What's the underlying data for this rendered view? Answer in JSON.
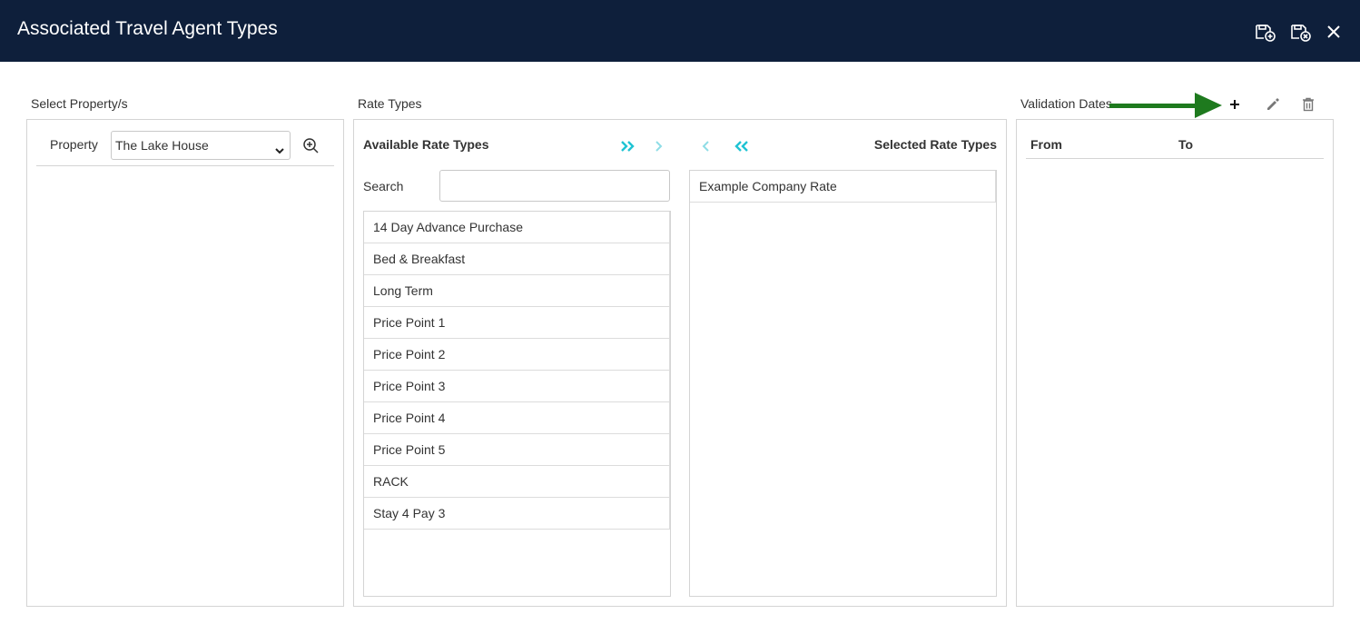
{
  "window": {
    "title": "Associated Travel Agent Types",
    "actions": [
      "save-add-icon",
      "save-close-icon",
      "close-icon"
    ]
  },
  "property_section": {
    "label": "Select Property/s",
    "property_label": "Property",
    "property_value": "The Lake House"
  },
  "rate_types": {
    "label": "Rate Types",
    "available_title": "Available Rate Types",
    "selected_title": "Selected Rate Types",
    "search_label": "Search",
    "search_value": "",
    "available_items": [
      "14 Day Advance Purchase",
      "Bed & Breakfast",
      "Long Term",
      "Price Point 1",
      "Price Point 2",
      "Price Point 3",
      "Price Point 4",
      "Price Point 5",
      "RACK",
      "Stay 4 Pay 3"
    ],
    "selected_items": [
      "Example Company Rate"
    ]
  },
  "validation_dates": {
    "label": "Validation Dates",
    "columns": [
      "From",
      "To"
    ]
  },
  "colors": {
    "title_bar": "#0e1f3b",
    "accent_teal": "#1fc3d3",
    "annotation_arrow": "#1e7a1e"
  }
}
